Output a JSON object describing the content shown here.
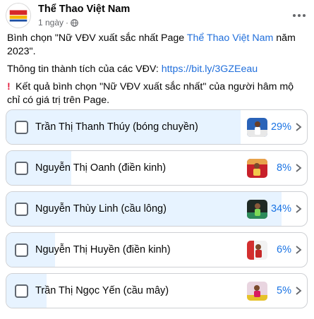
{
  "post": {
    "page_name": "Thể Thao Việt Nam",
    "time": "1 ngày",
    "dot": "·",
    "line1_before": "Bình chọn \"Nữ VĐV xuất sắc nhất Page ",
    "line1_link": "Thể Thao Việt Nam",
    "line1_after": " năm 2023\".",
    "line2_before": "Thông tin thành tích của các VĐV: ",
    "line2_link": "https://bit.ly/3GZEeau",
    "warning_icon": "exclamation-icon",
    "line3": "Kết quả bình chọn \"Nữ VĐV xuất sắc nhất\" của người hâm mộ chỉ có giá trị trên Page."
  },
  "poll": {
    "options": [
      {
        "label": "Trần Thị Thanh Thúy (bóng chuyền)",
        "percent_text": "29%",
        "fraction": 0.29
      },
      {
        "label": "Nguyễn Thị Oanh (điền kinh)",
        "percent_text": "8%",
        "fraction": 0.08
      },
      {
        "label": "Nguyễn Thùy Linh (cầu lông)",
        "percent_text": "34%",
        "fraction": 0.34
      },
      {
        "label": "Nguyễn Thị Huyền (điền kinh)",
        "percent_text": "6%",
        "fraction": 0.06
      },
      {
        "label": "Trần Thị Ngọc Yến (cầu mây)",
        "percent_text": "5%",
        "fraction": 0.05
      }
    ]
  },
  "colors": {
    "link": "#216fdb",
    "percent": "#1b74e4",
    "poll_fill": "#e7f3ff",
    "warning": "#e41e3f"
  }
}
